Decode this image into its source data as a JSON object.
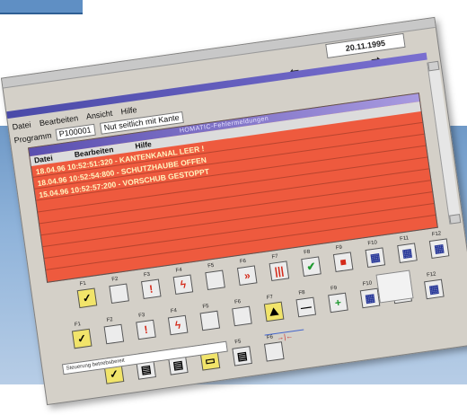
{
  "main_window": {
    "date": "20.11.1995",
    "arrow_left": "⬅",
    "arrow_right": "➡",
    "menu": [
      "Datei",
      "Bearbeiten",
      "Ansicht",
      "Hilfe"
    ],
    "program_label": "Programm",
    "program_value": "P100001",
    "program_desc": "Nut seitlich mit Kante"
  },
  "error_window": {
    "title": "HOMATIC-Fehlermeldungen",
    "menu": [
      "Datei",
      "Bearbeiten",
      "Hilfe"
    ],
    "rows": [
      "18.04.96 10:52:51:320 - KANTENKANAL LEER !",
      "18.04.96 10:52:54:800 - SCHUTZHAUBE OFFEN",
      "15.04.96 10:52:57:200 - VORSCHUB GESTOPPT"
    ]
  },
  "fkeys_top": [
    {
      "label": "F1",
      "icon": "check-icon",
      "glyph": "✓",
      "style": "yellow"
    },
    {
      "label": "F2",
      "icon": "blank-icon",
      "glyph": "",
      "style": ""
    },
    {
      "label": "F3",
      "icon": "warning-icon",
      "glyph": "!",
      "style": "red"
    },
    {
      "label": "F4",
      "icon": "lightning-icon",
      "glyph": "ϟ",
      "style": "red"
    },
    {
      "label": "F5",
      "icon": "blank-icon",
      "glyph": "",
      "style": ""
    },
    {
      "label": "F6",
      "icon": "fast-forward-icon",
      "glyph": "»",
      "style": "red"
    },
    {
      "label": "F7",
      "icon": "stop-bars-icon",
      "glyph": "|||",
      "style": "red"
    },
    {
      "label": "F8",
      "icon": "checkmark-icon",
      "glyph": "✔",
      "style": "green"
    },
    {
      "label": "F9",
      "icon": "stop-square-icon",
      "glyph": "■",
      "style": "red"
    },
    {
      "label": "F10",
      "icon": "grid-icon",
      "glyph": "▦",
      "style": "blue"
    },
    {
      "label": "F11",
      "icon": "grid-icon",
      "glyph": "▦",
      "style": "blue"
    },
    {
      "label": "F12",
      "icon": "grid-icon",
      "glyph": "▦",
      "style": "blue"
    }
  ],
  "fkeys_mid": [
    {
      "label": "F1",
      "icon": "check-icon",
      "glyph": "✓",
      "style": "yellow"
    },
    {
      "label": "F2",
      "icon": "blank-icon",
      "glyph": "",
      "style": ""
    },
    {
      "label": "F3",
      "icon": "warning-icon",
      "glyph": "!",
      "style": "red"
    },
    {
      "label": "F4",
      "icon": "lightning-icon",
      "glyph": "ϟ",
      "style": "red"
    },
    {
      "label": "F5",
      "icon": "blank-icon",
      "glyph": "",
      "style": ""
    },
    {
      "label": "F6",
      "icon": "blank-icon",
      "glyph": "",
      "style": ""
    },
    {
      "label": "F7",
      "icon": "chart-icon",
      "glyph": "⛰",
      "style": "yellow"
    },
    {
      "label": "F8",
      "icon": "minus-icon",
      "glyph": "—",
      "style": ""
    },
    {
      "label": "F9",
      "icon": "plus-icon",
      "glyph": "+",
      "style": "green"
    },
    {
      "label": "F10",
      "icon": "grid-icon",
      "glyph": "▦",
      "style": "blue"
    },
    {
      "label": "F11",
      "icon": "lightning-icon",
      "glyph": "ϟ",
      "style": "red"
    },
    {
      "label": "F12",
      "icon": "grid-icon",
      "glyph": "▦",
      "style": "blue"
    }
  ],
  "fkeys_bottom": [
    {
      "label": "F1",
      "icon": "check-icon",
      "glyph": "✓",
      "style": "yellow"
    },
    {
      "label": "F2",
      "icon": "document-icon",
      "glyph": "▤",
      "style": ""
    },
    {
      "label": "F3",
      "icon": "document-icon",
      "glyph": "▤",
      "style": ""
    },
    {
      "label": "F4",
      "icon": "folder-icon",
      "glyph": "▭",
      "style": "yellow"
    },
    {
      "label": "F5",
      "icon": "document-icon",
      "glyph": "▤",
      "style": ""
    },
    {
      "label": "F6",
      "icon": "blank-icon",
      "glyph": "",
      "style": ""
    }
  ],
  "status_text": "Steuerung betriebsbereit",
  "ruler_mark": "→|←"
}
